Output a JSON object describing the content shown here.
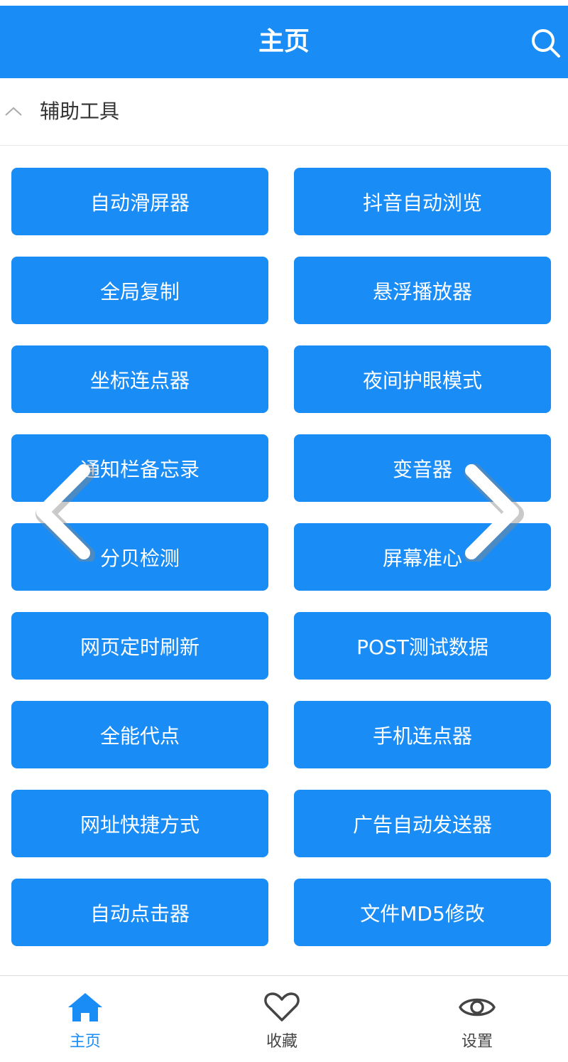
{
  "colors": {
    "accent": "#1a8cf5",
    "background": "#ffffff",
    "text": "#333333"
  },
  "header": {
    "title": "主页",
    "search_icon": "search-icon"
  },
  "section": {
    "title": "辅助工具",
    "toggle_icon": "chevron-up-icon"
  },
  "tools": [
    "自动滑屏器",
    "抖音自动浏览",
    "全局复制",
    "悬浮播放器",
    "坐标连点器",
    "夜间护眼模式",
    "通知栏备忘录",
    "变音器",
    "分贝检测",
    "屏幕准心",
    "网页定时刷新",
    "POST测试数据",
    "全能代点",
    "手机连点器",
    "网址快捷方式",
    "广告自动发送器",
    "自动点击器",
    "文件MD5修改"
  ],
  "overlay": {
    "prev_icon": "chevron-left-icon",
    "next_icon": "chevron-right-icon"
  },
  "bottom_nav": {
    "items": [
      {
        "label": "主页",
        "icon": "home-icon",
        "active": true
      },
      {
        "label": "收藏",
        "icon": "heart-icon",
        "active": false
      },
      {
        "label": "设置",
        "icon": "eye-icon",
        "active": false
      }
    ]
  }
}
